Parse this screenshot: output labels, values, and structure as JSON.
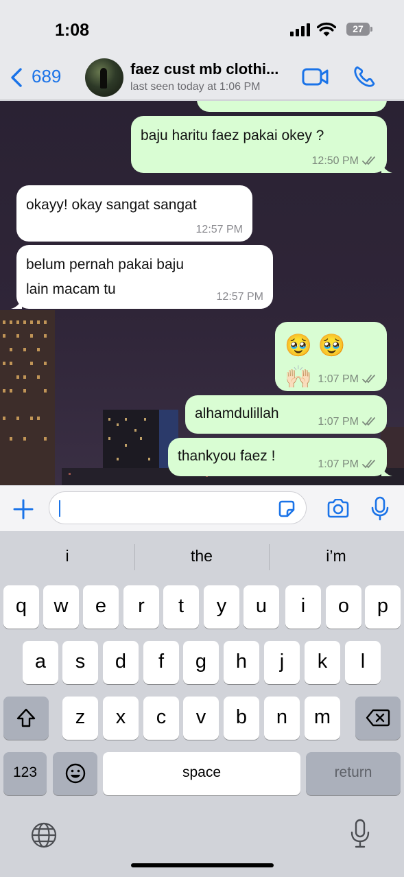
{
  "status_bar": {
    "time": "1:08",
    "battery": "27"
  },
  "header": {
    "back_count": "689",
    "contact_name": "faez cust mb clothi...",
    "last_seen": "last seen today at 1:06 PM"
  },
  "messages": [
    {
      "direction": "out",
      "text": "baju haritu faez pakai okey ?",
      "time": "12:50 PM",
      "read": true
    },
    {
      "direction": "in",
      "text": "okayy! okay sangat sangat",
      "time": "12:57 PM"
    },
    {
      "direction": "in",
      "text": "belum pernah pakai baju lain macam tu",
      "time": "12:57 PM"
    },
    {
      "direction": "out",
      "text": "🥹 🥹 🙌🏻",
      "time": "1:07 PM",
      "read": true
    },
    {
      "direction": "out",
      "text": "alhamdulillah",
      "time": "1:07 PM",
      "read": true
    },
    {
      "direction": "out",
      "text": "thankyou faez !",
      "time": "1:07 PM",
      "read": true
    }
  ],
  "composer": {
    "value": "",
    "placeholder": ""
  },
  "keyboard": {
    "suggestions": [
      "i",
      "the",
      "i’m"
    ],
    "row1": [
      "q",
      "w",
      "e",
      "r",
      "t",
      "y",
      "u",
      "i",
      "o",
      "p"
    ],
    "row2": [
      "a",
      "s",
      "d",
      "f",
      "g",
      "h",
      "j",
      "k",
      "l"
    ],
    "row3": [
      "z",
      "x",
      "c",
      "v",
      "b",
      "n",
      "m"
    ],
    "numbers_label": "123",
    "space_label": "space",
    "return_label": "return"
  },
  "icons": [
    "back-chevron-icon",
    "video-call-icon",
    "phone-icon",
    "plus-icon",
    "sticker-icon",
    "camera-icon",
    "mic-icon",
    "shift-icon",
    "backspace-icon",
    "emoji-icon",
    "globe-icon",
    "dictation-icon"
  ],
  "colors": {
    "accent": "#1a73e8",
    "outgoing_bubble": "#d9fdd3",
    "incoming_bubble": "#ffffff",
    "read_ticks": "#7d8a7d"
  }
}
